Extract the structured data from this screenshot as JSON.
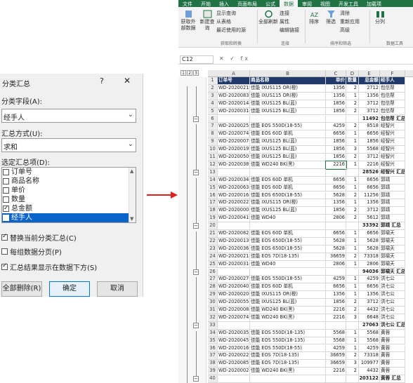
{
  "dialog": {
    "title": "分类汇总",
    "help": "?",
    "close": "✕",
    "field_label": "分类字段(A):",
    "field_value": "经手人",
    "method_label": "汇总方式(U):",
    "method_value": "求和",
    "items_label": "选定汇总项(D):",
    "items": [
      {
        "label": "订单号",
        "checked": false,
        "selected": false
      },
      {
        "label": "商品名称",
        "checked": false,
        "selected": false
      },
      {
        "label": "单价",
        "checked": false,
        "selected": false
      },
      {
        "label": "数量",
        "checked": false,
        "selected": false
      },
      {
        "label": "总金额",
        "checked": true,
        "selected": false
      },
      {
        "label": "经手人",
        "checked": false,
        "selected": true
      }
    ],
    "opt_replace": "替换当前分类汇总(C)",
    "opt_pagebreak": "每组数据分页(P)",
    "opt_below": "汇总结果显示在数据下方(S)",
    "btn_remove": "全部删除(R)",
    "btn_ok": "确定",
    "btn_cancel": "取消"
  },
  "excel": {
    "tabs": [
      "文件",
      "开始",
      "插入",
      "页面布局",
      "公式",
      "数据",
      "审阅",
      "视图",
      "开发工具",
      "加载项"
    ],
    "active_tab": "数据",
    "ribbon_buttons": [
      "获取外部数据",
      "新建查询",
      "显示查询",
      "从表格",
      "最近使用的源",
      "全部刷新",
      "连接",
      "属性",
      "编辑链接",
      "排序",
      "筛选",
      "清除",
      "重新应用",
      "高级",
      "分列"
    ],
    "group_labels": [
      "获取和转换",
      "连接",
      "排序和筛选",
      "数据工具"
    ],
    "name_box": "C12",
    "fx_symbols": "✕ ✓ fx",
    "outline_levels": [
      "1",
      "2",
      "3"
    ],
    "col_letters": [
      "A",
      "B",
      "C",
      "D",
      "E",
      "F"
    ],
    "rows": [
      {
        "n": "1",
        "a": "订单号",
        "b": "商品名称",
        "c": "单价",
        "d": "数量",
        "e": "总金额",
        "f": "经手人",
        "t": "hdr"
      },
      {
        "n": "2",
        "a": "WD-20200219",
        "b": "佳能 IXUS115 OR(橙)",
        "c": "1356",
        "d": "2",
        "e": "2712",
        "f": "包信帮"
      },
      {
        "n": "3",
        "a": "WD-20200836",
        "b": "佳能 IXUS115 OR(橙)",
        "c": "1356",
        "d": "1",
        "e": "1356",
        "f": "包信帮"
      },
      {
        "n": "4",
        "a": "WD-20200144",
        "b": "佳能 IXUS125 BL(蓝)",
        "c": "1856",
        "d": "2",
        "e": "3712",
        "f": "包信帮"
      },
      {
        "n": "5",
        "a": "WD-20200314",
        "b": "佳能 IXUS125 BL(蓝)",
        "c": "1856",
        "d": "2",
        "e": "3712",
        "f": "包信帮"
      },
      {
        "n": "6",
        "a": "",
        "b": "",
        "c": "",
        "d": "",
        "e": "11492",
        "f": "包信帮 汇总",
        "t": "sub"
      },
      {
        "n": "7",
        "a": "WD-20200257",
        "b": "佳能 EOS 550D(18-55)",
        "c": "4259",
        "d": "2",
        "e": "8518",
        "f": "经智兴"
      },
      {
        "n": "8",
        "a": "WD-20200740",
        "b": "佳能 EOS 60D 单机",
        "c": "6656",
        "d": "1",
        "e": "6656",
        "f": "经智兴"
      },
      {
        "n": "9",
        "a": "WD-20200074",
        "b": "佳能 IXUS125 BL(蓝)",
        "c": "1856",
        "d": "1",
        "e": "1856",
        "f": "经智兴"
      },
      {
        "n": "10",
        "a": "WD-20200199",
        "b": "佳能 IXUS125 BL(蓝)",
        "c": "1856",
        "d": "3",
        "e": "5568",
        "f": "经智兴"
      },
      {
        "n": "11",
        "a": "WD-20200509",
        "b": "佳能 IXUS125 BL(蓝)",
        "c": "1856",
        "d": "2",
        "e": "3712",
        "f": "经智兴"
      },
      {
        "n": "12",
        "a": "WD-20200389",
        "b": "佳能 WD240 BK(黑)",
        "c": "2216",
        "d": "1",
        "e": "2216",
        "f": "经智兴",
        "t": "sel"
      },
      {
        "n": "13",
        "a": "",
        "b": "",
        "c": "",
        "d": "",
        "e": "28526",
        "f": "经智兴 汇总",
        "t": "sub"
      },
      {
        "n": "14",
        "a": "WD-20200340",
        "b": "佳能 EOS 60D 单机",
        "c": "6656",
        "d": "1",
        "e": "6656",
        "f": "郭靖"
      },
      {
        "n": "15",
        "a": "WD-20200638",
        "b": "佳能 EOS 60D 单机",
        "c": "6656",
        "d": "1",
        "e": "6656",
        "f": "郭靖"
      },
      {
        "n": "16",
        "a": "WD-20200163",
        "b": "佳能 EOS 650D(18-55)",
        "c": "5628",
        "d": "2",
        "e": "11256",
        "f": "郭靖"
      },
      {
        "n": "17",
        "a": "WD-20200225",
        "b": "佳能 IXUS115 OR(橙)",
        "c": "1356",
        "d": "1",
        "e": "1356",
        "f": "郭靖"
      },
      {
        "n": "18",
        "a": "WD-20200002",
        "b": "佳能 IXUS125 BL(蓝)",
        "c": "1856",
        "d": "2",
        "e": "3712",
        "f": "郭靖"
      },
      {
        "n": "19",
        "a": "WD-20200419",
        "b": "佳能 WD40",
        "c": "2806",
        "d": "2",
        "e": "5612",
        "f": "郭靖"
      },
      {
        "n": "20",
        "a": "",
        "b": "",
        "c": "",
        "d": "",
        "e": "33392",
        "f": "郭靖 汇总",
        "t": "sub"
      },
      {
        "n": "21",
        "a": "WD-20200827",
        "b": "佳能 EOS 60D 单机",
        "c": "6656",
        "d": "1",
        "e": "6656",
        "f": "郭啸天"
      },
      {
        "n": "22",
        "a": "WD-20200131",
        "b": "佳能 EOS 650D(18-55)",
        "c": "5628",
        "d": "1",
        "e": "5628",
        "f": "郭啸天"
      },
      {
        "n": "23",
        "a": "WD-20200361",
        "b": "佳能 EOS 650D(18-55)",
        "c": "5628",
        "d": "1",
        "e": "5628",
        "f": "郭啸天"
      },
      {
        "n": "24",
        "a": "WD-20200212",
        "b": "佳能 EOS 7D(18-135)",
        "c": "36659",
        "d": "2",
        "e": "73318",
        "f": "郭啸天"
      },
      {
        "n": "25",
        "a": "WD-20200310",
        "b": "佳能 WD40",
        "c": "2806",
        "d": "1",
        "e": "2806",
        "f": "郭啸天"
      },
      {
        "n": "26",
        "a": "",
        "b": "",
        "c": "",
        "d": "",
        "e": "94036",
        "f": "郭啸天 汇总",
        "t": "sub"
      },
      {
        "n": "27",
        "a": "WD-20200270",
        "b": "佳能 EOS 550D(18-55)",
        "c": "4259",
        "d": "1",
        "e": "4259",
        "f": "洪七公"
      },
      {
        "n": "28",
        "a": "WD-20200405",
        "b": "佳能 EOS 60D 单机",
        "c": "6656",
        "d": "1",
        "e": "6656",
        "f": "洪七公"
      },
      {
        "n": "29",
        "a": "WD-20200200",
        "b": "佳能 IXUS115 OR(橙)",
        "c": "1356",
        "d": "1",
        "e": "1356",
        "f": "洪七公"
      },
      {
        "n": "30",
        "a": "WD-20200551",
        "b": "佳能 IXUS125 BL(蓝)",
        "c": "1856",
        "d": "2",
        "e": "3712",
        "f": "洪七公"
      },
      {
        "n": "31",
        "a": "WD-20200084",
        "b": "佳能 WD240 BK(黑)",
        "c": "2216",
        "d": "2",
        "e": "4432",
        "f": "洪七公"
      },
      {
        "n": "32",
        "a": "WD-20200748",
        "b": "佳能 WD240 BK(黑)",
        "c": "2216",
        "d": "3",
        "e": "6648",
        "f": "洪七公"
      },
      {
        "n": "33",
        "a": "",
        "b": "",
        "c": "",
        "d": "",
        "e": "27063",
        "f": "洪七公 汇总",
        "t": "sub"
      },
      {
        "n": "34",
        "a": "WD-20200352",
        "b": "佳能 EOS 550D(18-135)",
        "c": "5568",
        "d": "1",
        "e": "5568",
        "f": "黄蓉"
      },
      {
        "n": "35",
        "a": "WD-20200459",
        "b": "佳能 EOS 550D(18-135)",
        "c": "5568",
        "d": "1",
        "e": "5568",
        "f": "黄蓉"
      },
      {
        "n": "36",
        "a": "WD-20200166",
        "b": "佳能 EOS 550D(18-55)",
        "c": "4259",
        "d": "1",
        "e": "4259",
        "f": "黄蓉"
      },
      {
        "n": "37",
        "a": "WD-20200229",
        "b": "佳能 EOS 7D(18-135)",
        "c": "36659",
        "d": "2",
        "e": "73318",
        "f": "黄蓉"
      },
      {
        "n": "38",
        "a": "WD-20200859",
        "b": "佳能 EOS 7D(18-135)",
        "c": "36659",
        "d": "3",
        "e": "109977",
        "f": "黄蓉"
      },
      {
        "n": "39",
        "a": "WD-20200024",
        "b": "佳能 WD240 BK(黑)",
        "c": "2216",
        "d": "2",
        "e": "4432",
        "f": "黄蓉"
      },
      {
        "n": "40",
        "a": "",
        "b": "",
        "c": "",
        "d": "",
        "e": "203122",
        "f": "黄蓉 汇总",
        "t": "sub"
      }
    ]
  },
  "colors": {
    "excel_green": "#217346",
    "header_navy": "#1f3a68",
    "arrow_red": "#e02020",
    "select_blue": "#0a63c9"
  }
}
